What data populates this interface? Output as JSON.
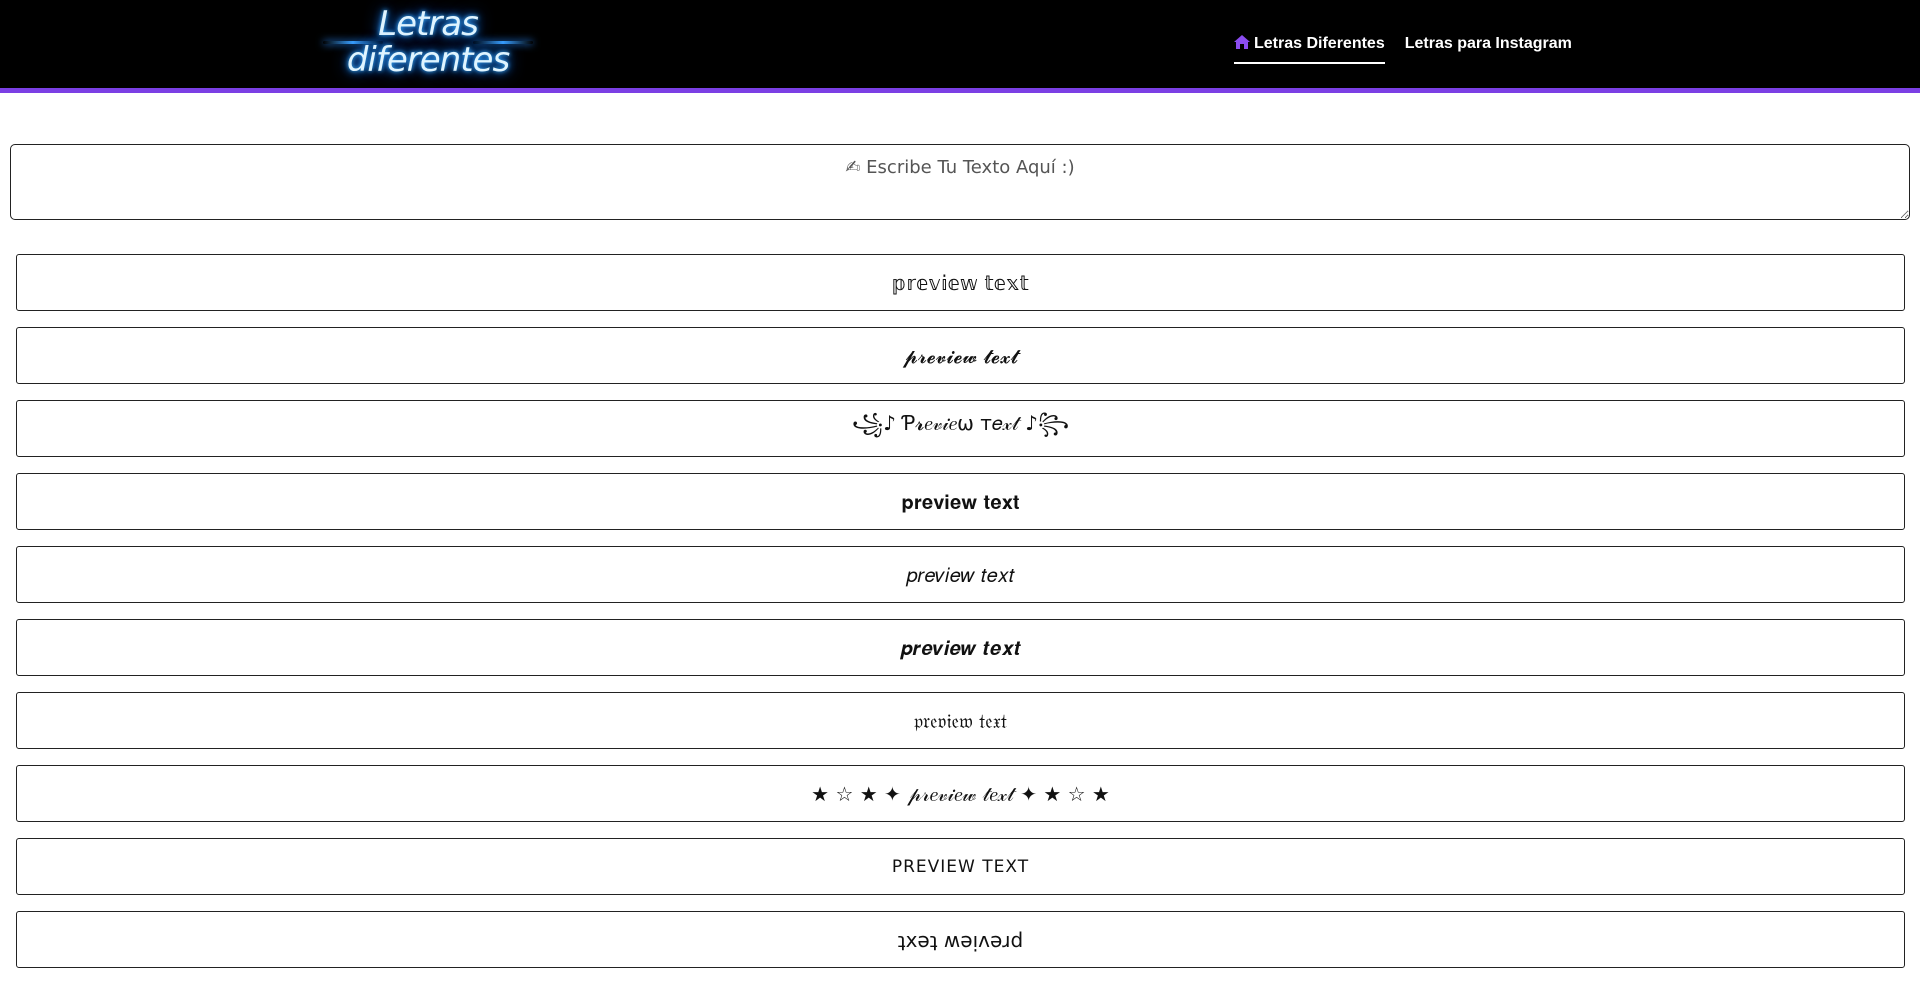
{
  "header": {
    "logo_line1": "Letras",
    "logo_line2": "diferentes",
    "nav": [
      {
        "label": "Letras Diferentes",
        "icon": "home-icon",
        "active": true
      },
      {
        "label": "Letras para Instagram",
        "active": false
      }
    ],
    "accent_color": "#7b3fe4"
  },
  "input": {
    "placeholder": "✍ Escribe Tu Texto Aquí :)"
  },
  "results": [
    "𝕡𝕣𝕖𝕧𝕚𝕖𝕨 𝕥𝕖𝕩𝕥",
    "𝓹𝓻𝓮𝓿𝓲𝓮𝔀 𝓽𝓮𝔁𝓽",
    "꧁♪ Ƥ𝓻𝑒𝓋𝒾𝑒ω т𝑒𝓍𝓉 ♪꧂",
    "𝐩𝐫𝐞𝐯𝐢𝐞𝐰 𝐭𝐞𝐱𝐭",
    "𝑝𝑟𝑒𝑣𝑖𝑒𝑤 𝑡𝑒𝑥𝑡",
    "𝒑𝒓𝒆𝒗𝒊𝒆𝒘 𝒕𝒆𝒙𝒕",
    "𝔭𝔯𝔢𝔳𝔦𝔢𝔴 𝔱𝔢𝔵𝔱",
    "★ ☆ ★ ✦ 𝓅𝓇𝑒𝓋𝒾𝑒𝓌 𝓉𝑒𝓍𝓉 ✦ ★ ☆ ★",
    "PREVIEW TEXT",
    "ʇxǝʇ ʍǝᴉʌǝɹd"
  ]
}
